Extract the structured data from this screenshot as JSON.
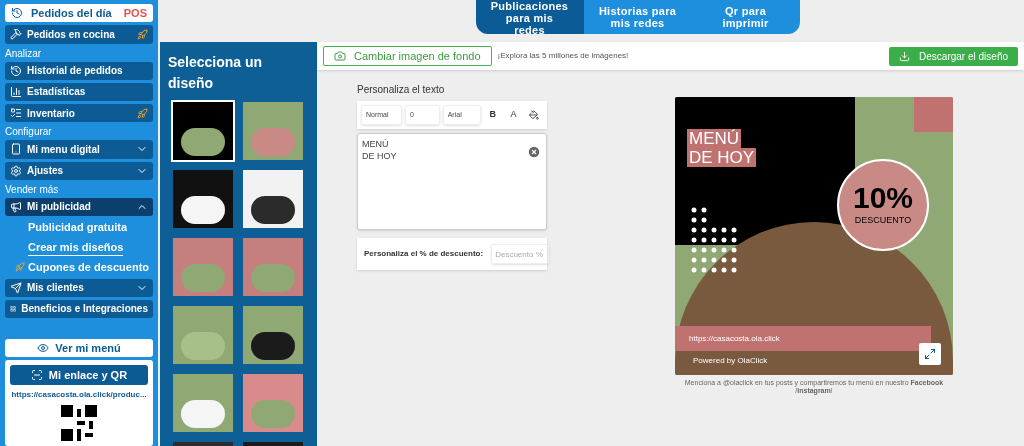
{
  "sidebar": {
    "items": [
      {
        "kind": "top",
        "label": "Pedidos del día",
        "badge": "POS"
      },
      {
        "kind": "item",
        "label": "Pedidos en cocina",
        "rocket": true
      },
      {
        "kind": "header",
        "label": "Analizar"
      },
      {
        "kind": "item",
        "label": "Historial de pedidos",
        "rocket": false
      },
      {
        "kind": "item",
        "label": "Estadísticas",
        "rocket": false
      },
      {
        "kind": "item",
        "label": "Inventario",
        "rocket": true
      },
      {
        "kind": "header",
        "label": "Configurar"
      },
      {
        "kind": "item",
        "label": "Mi menu digital",
        "rocket": false,
        "expanded": false
      },
      {
        "kind": "item",
        "label": "Ajustes",
        "rocket": false,
        "expanded": false
      },
      {
        "kind": "header",
        "label": "Vender más"
      },
      {
        "kind": "item",
        "label": "Mi publicidad",
        "rocket": false,
        "expanded": true
      },
      {
        "kind": "sub",
        "label": "Publicidad gratuita",
        "selected": false,
        "rocket": false
      },
      {
        "kind": "sub",
        "label": "Crear mis diseños",
        "selected": true,
        "rocket": false
      },
      {
        "kind": "sub",
        "label": "Cupones de descuento",
        "selected": false,
        "rocket": true
      },
      {
        "kind": "item",
        "label": "Mis clientes",
        "rocket": false,
        "expanded": false
      },
      {
        "kind": "item",
        "label": "Beneficios e Integraciones",
        "rocket": false
      }
    ],
    "view_menu": "Ver mi menú",
    "link_button": "Mi enlace y QR",
    "link_url": "https://casacosta.ola.click/produc..."
  },
  "tabs": [
    {
      "label": "Publicaciones para mis redes",
      "selected": true
    },
    {
      "label": "Historias para mis redes",
      "selected": false
    },
    {
      "label": "Qr para imprimir",
      "selected": false
    }
  ],
  "designs_panel": {
    "title": "Selecciona un diseño",
    "designs": [
      {
        "selected": true
      },
      {
        "selected": false
      },
      {
        "selected": false
      },
      {
        "selected": false
      },
      {
        "selected": false
      },
      {
        "selected": false
      },
      {
        "selected": false
      },
      {
        "selected": false
      },
      {
        "selected": false
      },
      {
        "selected": false
      },
      {
        "selected": false
      },
      {
        "selected": false
      }
    ]
  },
  "toolbar": {
    "change_background": "Cambiar imagen de fondo",
    "hint": "¡Explora las 5 millones de imágenes!",
    "download": "Descargar el diseño"
  },
  "editor": {
    "title": "Personaliza el texto",
    "style": "Normal",
    "size": "0",
    "font": "Arial",
    "bold": "B",
    "text_color_label": "A",
    "text": "MENÚ\nDE HOY",
    "discount_label": "Personaliza el % de descuento:",
    "discount_placeholder": "Descuento %"
  },
  "preview": {
    "headline_1": "MENÚ",
    "headline_2": "DE HOY",
    "discount": "10%",
    "discount_caption": "DESCUENTO",
    "url": "https://casacosta.ola.click",
    "powered": "Powered by OlaClick",
    "caption": "Menciona a @olaclick en tus posts y compartiremos tu menú en nuestro **Facebook** /**Instagram**!"
  }
}
